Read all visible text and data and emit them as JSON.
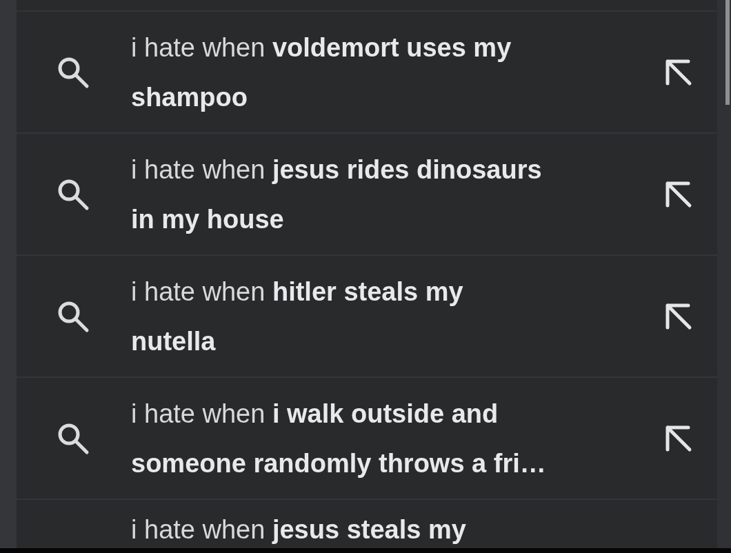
{
  "suggestions": [
    {
      "lines": [
        "i hate when **voldemort uses my**",
        "**shampoo**"
      ]
    },
    {
      "lines": [
        "i hate when **jesus rides dinosaurs**",
        "**in my house**"
      ]
    },
    {
      "lines": [
        "i hate when **hitler steals my**",
        "**nutella**"
      ]
    },
    {
      "lines": [
        "i hate when **i walk outside and**",
        "**someone randomly throws a fri…**"
      ]
    },
    {
      "lines": [
        "i hate when **jesus steals my**"
      ]
    }
  ]
}
